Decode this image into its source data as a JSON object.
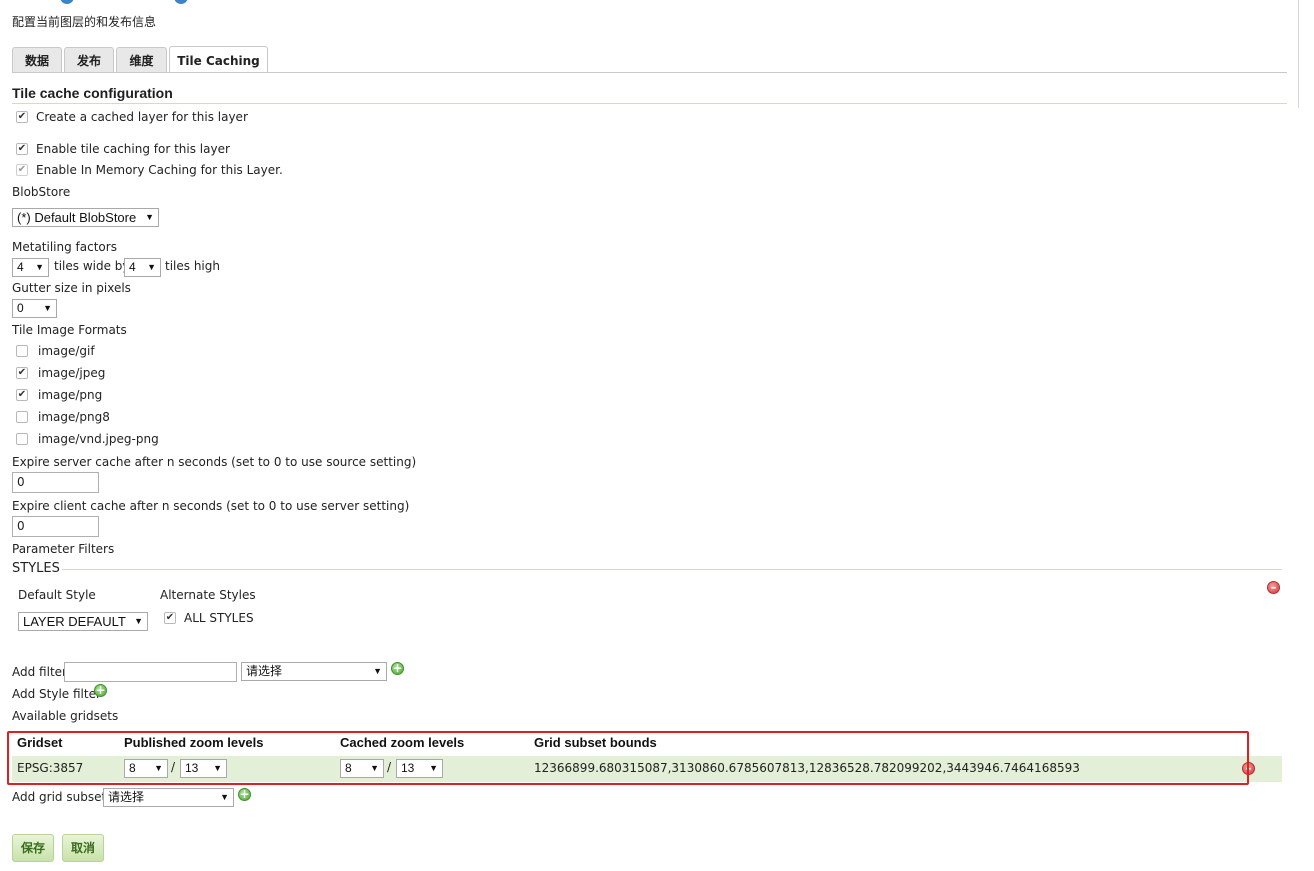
{
  "header": {
    "subtitle": "配置当前图层的和发布信息"
  },
  "tabs": [
    {
      "label": "数据"
    },
    {
      "label": "发布"
    },
    {
      "label": "维度"
    },
    {
      "label": "Tile Caching"
    }
  ],
  "section_title": "Tile cache configuration",
  "checkboxes": {
    "create_cached_layer": {
      "label": "Create a cached layer for this layer",
      "checked": true
    },
    "enable_tile_caching": {
      "label": "Enable tile caching for this layer",
      "checked": true
    },
    "enable_in_memory": {
      "label": "Enable In Memory Caching for this Layer.",
      "checked": true
    }
  },
  "blobstore": {
    "label": "BlobStore",
    "value": "(*) Default BlobStore"
  },
  "metatiling": {
    "label": "Metatiling factors",
    "wide_value": "4",
    "wide_text": "tiles wide by",
    "high_value": "4",
    "high_text": "tiles high"
  },
  "gutter": {
    "label": "Gutter size in pixels",
    "value": "0"
  },
  "formats": {
    "label": "Tile Image Formats",
    "items": [
      {
        "label": "image/gif",
        "checked": false
      },
      {
        "label": "image/jpeg",
        "checked": true
      },
      {
        "label": "image/png",
        "checked": true
      },
      {
        "label": "image/png8",
        "checked": false
      },
      {
        "label": "image/vnd.jpeg-png",
        "checked": false
      }
    ]
  },
  "expire_server": {
    "label": "Expire server cache after n seconds (set to 0 to use source setting)",
    "value": "0"
  },
  "expire_client": {
    "label": "Expire client cache after n seconds (set to 0 to use server setting)",
    "value": "0"
  },
  "parameter_filters": {
    "label": "Parameter Filters",
    "styles_legend": "STYLES",
    "default_style_label": "Default Style",
    "default_style_value": "LAYER DEFAULT",
    "alternate_styles_label": "Alternate Styles",
    "all_styles_label": "ALL STYLES"
  },
  "add_filter": {
    "label": "Add filter",
    "input_value": "",
    "select_value": "请选择"
  },
  "add_style_filter": {
    "label": "Add Style filter"
  },
  "gridsets": {
    "label": "Available gridsets",
    "headers": [
      "Gridset",
      "Published zoom levels",
      "Cached zoom levels",
      "Grid subset bounds"
    ],
    "rows": [
      {
        "gridset": "EPSG:3857",
        "published_min": "8",
        "published_max": "13",
        "cached_min": "8",
        "cached_max": "13",
        "slash": "/",
        "bounds": "12366899.680315087,3130860.6785607813,12836528.782099202,3443946.7464168593"
      }
    ]
  },
  "add_grid_subset": {
    "label": "Add grid subset:",
    "select_value": "请选择"
  },
  "buttons": {
    "save": "保存",
    "cancel": "取消"
  },
  "colors": {
    "highlight_box": "#e02020",
    "row_bg": "#e3efd6",
    "button_green": "#c8e2a9"
  }
}
